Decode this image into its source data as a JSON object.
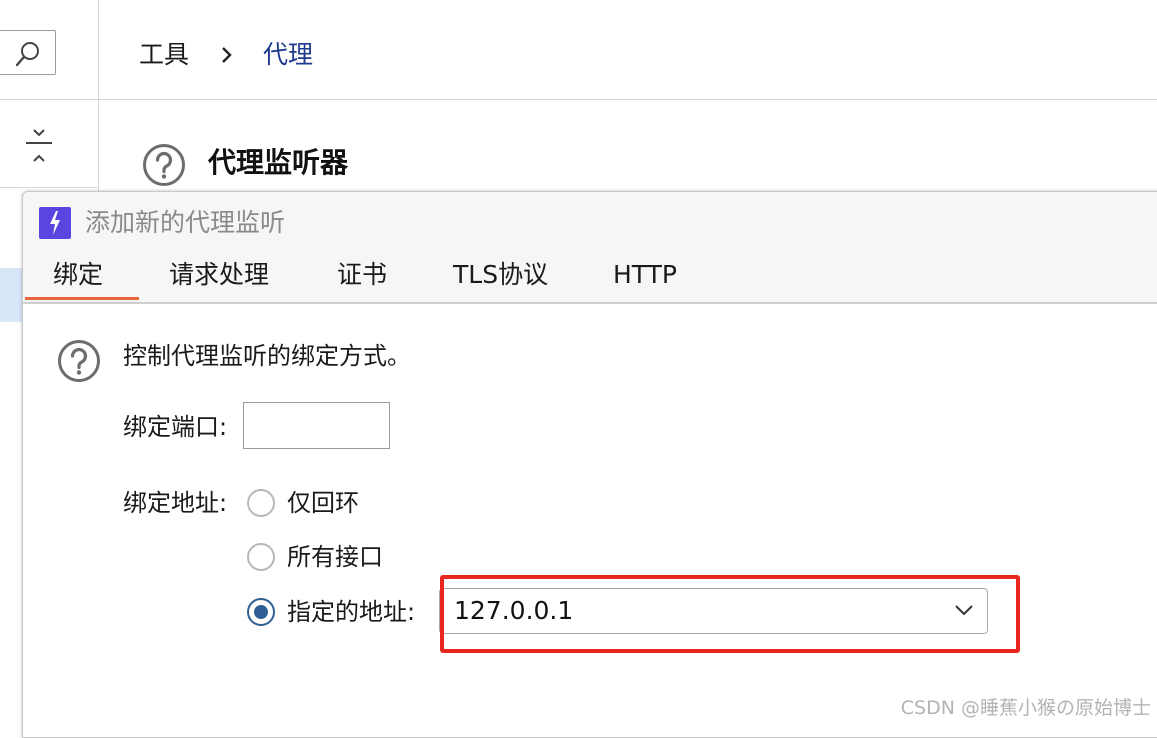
{
  "breadcrumb": {
    "parent": "工具",
    "separator_icon": "chevron-right-icon",
    "current": "代理"
  },
  "section": {
    "title": "代理监听器"
  },
  "dialog": {
    "title": "添加新的代理监听",
    "tabs": [
      {
        "label": "绑定",
        "active": true
      },
      {
        "label": "请求处理",
        "active": false
      },
      {
        "label": "证书",
        "active": false
      },
      {
        "label": "TLS协议",
        "active": false
      },
      {
        "label": "HTTP",
        "active": false
      }
    ],
    "description": "控制代理监听的绑定方式。",
    "port_label": "绑定端口:",
    "port_value": "",
    "address_label": "绑定地址:",
    "address_options": [
      {
        "label": "仅回环",
        "checked": false
      },
      {
        "label": "所有接口",
        "checked": false
      },
      {
        "label": "指定的地址:",
        "checked": true
      }
    ],
    "specified_address": "127.0.0.1"
  },
  "colors": {
    "accent_tab": "#e8643a",
    "highlight": "#e8261d",
    "radio_checked": "#2e5e93",
    "app_icon": "#5b45e0"
  },
  "watermark": "CSDN @睡蕉小猴の原始博士"
}
